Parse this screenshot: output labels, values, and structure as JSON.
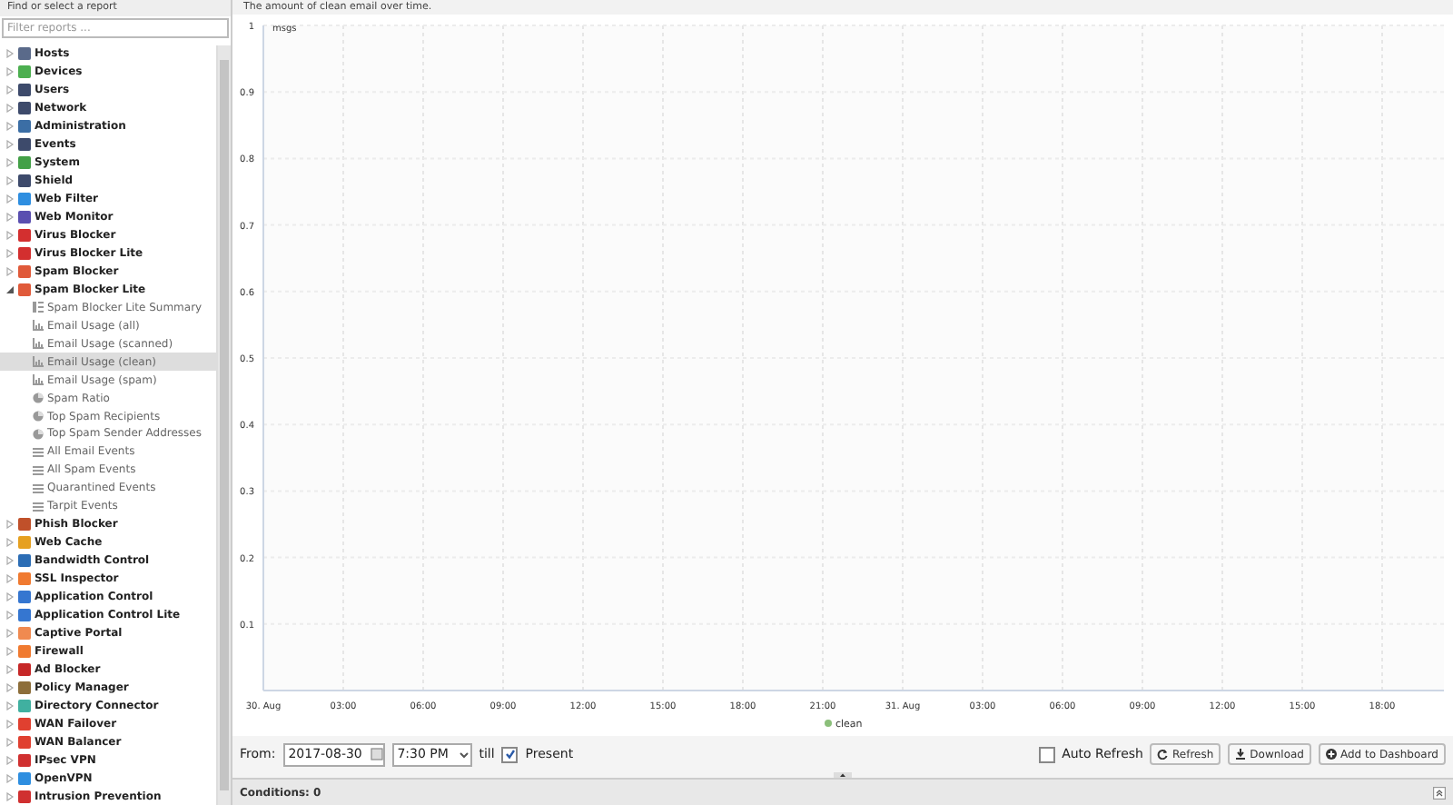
{
  "sidebar": {
    "title": "Find or select a report",
    "filter": {
      "placeholder": "Filter reports ..."
    },
    "items": [
      {
        "label": "Hosts",
        "color": "#5a6a8a",
        "expanded": false
      },
      {
        "label": "Devices",
        "color": "#4caf50",
        "expanded": false
      },
      {
        "label": "Users",
        "color": "#3d4a6b",
        "expanded": false
      },
      {
        "label": "Network",
        "color": "#3d4a6b",
        "expanded": false
      },
      {
        "label": "Administration",
        "color": "#3b6ea5",
        "expanded": false
      },
      {
        "label": "Events",
        "color": "#3d4a6b",
        "expanded": false
      },
      {
        "label": "System",
        "color": "#43a047",
        "expanded": false
      },
      {
        "label": "Shield",
        "color": "#3d4a6b",
        "expanded": false
      },
      {
        "label": "Web Filter",
        "color": "#2e8ee0",
        "expanded": false
      },
      {
        "label": "Web Monitor",
        "color": "#5a4fb0",
        "expanded": false
      },
      {
        "label": "Virus Blocker",
        "color": "#d32f2f",
        "expanded": false
      },
      {
        "label": "Virus Blocker Lite",
        "color": "#d32f2f",
        "expanded": false
      },
      {
        "label": "Spam Blocker",
        "color": "#e05a3a",
        "expanded": false
      },
      {
        "label": "Spam Blocker Lite",
        "color": "#e05a3a",
        "expanded": true,
        "children": [
          {
            "label": "Spam Blocker Lite Summary",
            "kind": "summary",
            "selected": false
          },
          {
            "label": "Email Usage (all)",
            "kind": "chart",
            "selected": false
          },
          {
            "label": "Email Usage (scanned)",
            "kind": "chart",
            "selected": false
          },
          {
            "label": "Email Usage (clean)",
            "kind": "chart",
            "selected": true
          },
          {
            "label": "Email Usage (spam)",
            "kind": "chart",
            "selected": false
          },
          {
            "label": "Spam Ratio",
            "kind": "pie",
            "selected": false
          },
          {
            "label": "Top Spam Recipients",
            "kind": "pie",
            "selected": false
          },
          {
            "label": "Top Spam Sender Addresses",
            "kind": "pie",
            "selected": false
          },
          {
            "label": "All Email Events",
            "kind": "list",
            "selected": false
          },
          {
            "label": "All Spam Events",
            "kind": "list",
            "selected": false
          },
          {
            "label": "Quarantined Events",
            "kind": "list",
            "selected": false
          },
          {
            "label": "Tarpit Events",
            "kind": "list",
            "selected": false
          }
        ]
      },
      {
        "label": "Phish Blocker",
        "color": "#c0502a",
        "expanded": false
      },
      {
        "label": "Web Cache",
        "color": "#e6a020",
        "expanded": false
      },
      {
        "label": "Bandwidth Control",
        "color": "#2c6db5",
        "expanded": false
      },
      {
        "label": "SSL Inspector",
        "color": "#f07a30",
        "expanded": false
      },
      {
        "label": "Application Control",
        "color": "#3576d0",
        "expanded": false
      },
      {
        "label": "Application Control Lite",
        "color": "#3576d0",
        "expanded": false
      },
      {
        "label": "Captive Portal",
        "color": "#f08a50",
        "expanded": false
      },
      {
        "label": "Firewall",
        "color": "#f07a30",
        "expanded": false
      },
      {
        "label": "Ad Blocker",
        "color": "#c62828",
        "expanded": false
      },
      {
        "label": "Policy Manager",
        "color": "#8d6e3a",
        "expanded": false
      },
      {
        "label": "Directory Connector",
        "color": "#40b0a0",
        "expanded": false
      },
      {
        "label": "WAN Failover",
        "color": "#e04030",
        "expanded": false
      },
      {
        "label": "WAN Balancer",
        "color": "#e04030",
        "expanded": false
      },
      {
        "label": "IPsec VPN",
        "color": "#d03030",
        "expanded": false
      },
      {
        "label": "OpenVPN",
        "color": "#2e8ee0",
        "expanded": false
      },
      {
        "label": "Intrusion Prevention",
        "color": "#d03030",
        "expanded": false
      }
    ]
  },
  "report": {
    "description": "The amount of clean email over time.",
    "chart_data": {
      "type": "line",
      "ylabel": "msgs",
      "categories": [
        "30. Aug",
        "03:00",
        "06:00",
        "09:00",
        "12:00",
        "15:00",
        "18:00",
        "21:00",
        "31. Aug",
        "03:00",
        "06:00",
        "09:00",
        "12:00",
        "15:00",
        "18:00"
      ],
      "grid": true,
      "yticks": [
        0.1,
        0.2,
        0.3,
        0.4,
        0.5,
        0.6,
        0.7,
        0.8,
        0.9,
        1
      ],
      "ylim": [
        0,
        1
      ],
      "series": [
        {
          "name": "clean",
          "color": "#8bbf7a",
          "values": [
            null,
            null,
            null,
            null,
            null,
            null,
            null,
            null,
            null,
            null,
            null,
            null,
            null,
            null,
            null
          ]
        }
      ]
    }
  },
  "toolbar": {
    "from_label": "From:",
    "date": "2017-08-30",
    "time": "7:30 PM",
    "till_label": "till",
    "present": {
      "label": "Present",
      "checked": true
    },
    "auto_refresh": {
      "label": "Auto Refresh",
      "checked": false
    },
    "buttons": [
      {
        "label": "Refresh",
        "kind": "refresh"
      },
      {
        "label": "Download",
        "kind": "download"
      },
      {
        "label": "Add to Dashboard",
        "kind": "add"
      }
    ]
  },
  "conditions": {
    "label": "Conditions: 0"
  }
}
